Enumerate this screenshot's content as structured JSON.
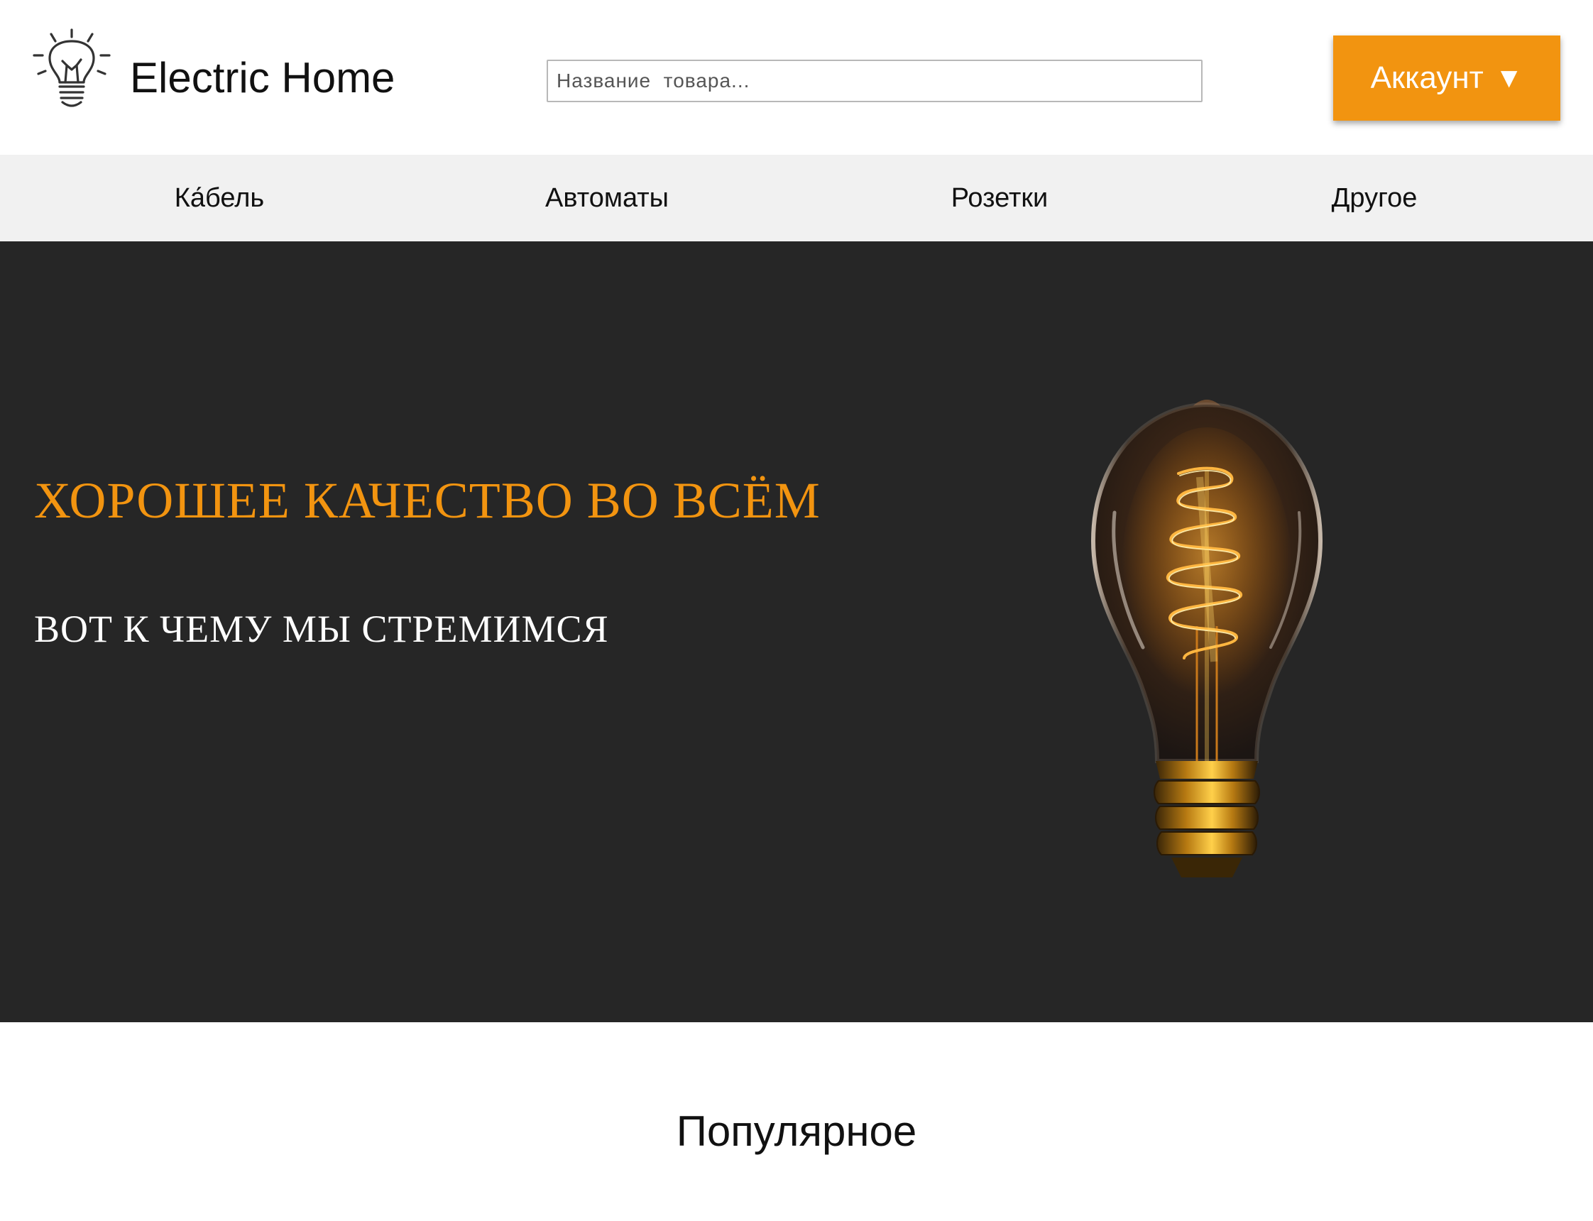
{
  "header": {
    "brand": "Electric Home",
    "logo_icon": "lightbulb-icon",
    "search": {
      "placeholder": "Название  товара...",
      "value": ""
    },
    "account": {
      "label": "Аккаунт",
      "caret": "▼",
      "color": "#f29410"
    }
  },
  "nav": {
    "items": [
      {
        "label": "Ка́бель"
      },
      {
        "label": "Автоматы"
      },
      {
        "label": "Розетки"
      },
      {
        "label": "Другое"
      }
    ]
  },
  "hero": {
    "title": "ХОРОШЕЕ КАЧЕСТВО ВО ВСЁМ",
    "subtitle": "ВОТ К ЧЕМУ МЫ СТРЕМИМСЯ",
    "image": "edison-bulb-image",
    "background": "#262626",
    "title_color": "#f29410"
  },
  "popular": {
    "heading": "Популярное"
  }
}
